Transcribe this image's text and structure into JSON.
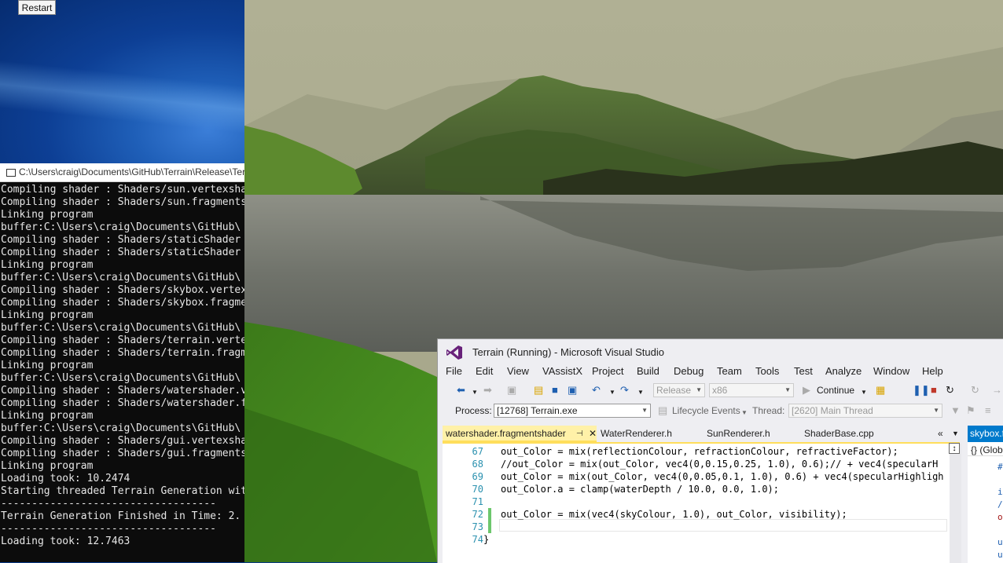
{
  "desktop": {
    "restart_button": "Restart"
  },
  "console": {
    "title": "C:\\Users\\craig\\Documents\\GitHub\\Terrain\\Release\\Terrain.exe",
    "lines": [
      "Compiling shader : Shaders/sun.vertexshader",
      "Compiling shader : Shaders/sun.fragmentshader",
      "Linking program",
      "buffer:C:\\Users\\craig\\Documents\\GitHub\\",
      "Compiling shader : Shaders/staticShader",
      "Compiling shader : Shaders/staticShader",
      "Linking program",
      "buffer:C:\\Users\\craig\\Documents\\GitHub\\",
      "Compiling shader : Shaders/skybox.vertexshader",
      "Compiling shader : Shaders/skybox.fragmentshader",
      "Linking program",
      "buffer:C:\\Users\\craig\\Documents\\GitHub\\",
      "Compiling shader : Shaders/terrain.vertexshader",
      "Compiling shader : Shaders/terrain.fragmentshader",
      "Linking program",
      "buffer:C:\\Users\\craig\\Documents\\GitHub\\",
      "Compiling shader : Shaders/watershader.vertexshader",
      "Compiling shader : Shaders/watershader.fragmentshader",
      "Linking program",
      "buffer:C:\\Users\\craig\\Documents\\GitHub\\",
      "Compiling shader : Shaders/gui.vertexshader",
      "Compiling shader : Shaders/gui.fragmentshader",
      "Linking program",
      "Loading took: 10.2474",
      "Starting threaded Terrain Generation with",
      "-----------------------------------",
      "Terrain Generation Finished in Time: 2.",
      "-----------------------------------",
      "Loading took: 12.7463"
    ]
  },
  "vs": {
    "title": "Terrain (Running) - Microsoft Visual Studio",
    "menu": [
      "File",
      "Edit",
      "View",
      "VAssistX",
      "Project",
      "Build",
      "Debug",
      "Team",
      "Tools",
      "Test",
      "Analyze",
      "Window",
      "Help"
    ],
    "toolbar": {
      "config": "Release",
      "platform": "x86",
      "continue_label": "Continue",
      "process_label": "Process:",
      "process_value": "[12768] Terrain.exe",
      "lifecycle_label": "Lifecycle Events",
      "thread_label": "Thread:",
      "thread_value": "[2620] Main Thread"
    },
    "tabs": [
      "watershader.fragmentshader",
      "WaterRenderer.h",
      "SunRenderer.h",
      "ShaderBase.cpp"
    ],
    "side_tab": "skybox.f",
    "side_scope": "{} (Glob",
    "code": [
      {
        "n": "67",
        "t": "out_Color = mix(reflectionColour, refractionColour, refractiveFactor);"
      },
      {
        "n": "68",
        "t": "//out_Color = mix(out_Color, vec4(0,0.15,0.25, 1.0), 0.6);// + vec4(specularH"
      },
      {
        "n": "69",
        "t": "out_Color = mix(out_Color, vec4(0,0.05,0.1, 1.0), 0.6) + vec4(specularHighligh"
      },
      {
        "n": "70",
        "t": "out_Color.a = clamp(waterDepth / 10.0, 0.0, 1.0);"
      },
      {
        "n": "71",
        "t": ""
      },
      {
        "n": "72",
        "t": "out_Color = mix(vec4(skyColour, 1.0), out_Color, visibility);"
      },
      {
        "n": "73",
        "t": ""
      },
      {
        "n": "74",
        "t": "}"
      }
    ]
  },
  "colors": {
    "vs_accent": "#007acc",
    "active_tab": "#fff1a8",
    "console_bg": "#0c0c0c"
  }
}
